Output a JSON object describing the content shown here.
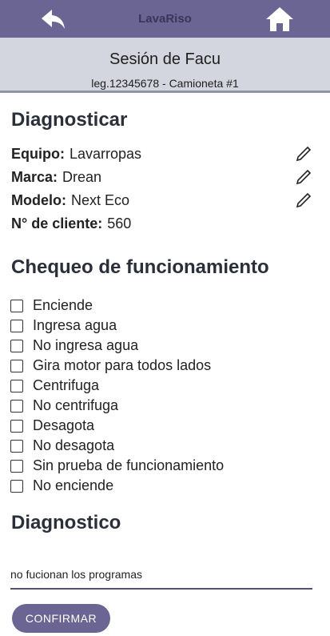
{
  "app": {
    "title": "LavaRiso"
  },
  "session": {
    "title": "Sesión de Facu",
    "subtitle": "leg.12345678 - Camioneta #1"
  },
  "diagnose": {
    "heading": "Diagnosticar",
    "fields": [
      {
        "label": "Equipo:",
        "value": "Lavarropas",
        "editable": true
      },
      {
        "label": "Marca:",
        "value": "Drean",
        "editable": true
      },
      {
        "label": "Modelo:",
        "value": "Next Eco",
        "editable": true
      },
      {
        "label": "N° de cliente:",
        "value": "560",
        "editable": false
      }
    ]
  },
  "checks": {
    "heading": "Chequeo de funcionamiento",
    "items": [
      {
        "label": "Enciende",
        "checked": false
      },
      {
        "label": "Ingresa agua",
        "checked": false
      },
      {
        "label": "No ingresa agua",
        "checked": false
      },
      {
        "label": "Gira motor para todos lados",
        "checked": false
      },
      {
        "label": "Centrifuga",
        "checked": false
      },
      {
        "label": "No centrifuga",
        "checked": false
      },
      {
        "label": "Desagota",
        "checked": false
      },
      {
        "label": "No desagota",
        "checked": false
      },
      {
        "label": "Sin prueba de funcionamiento",
        "checked": false
      },
      {
        "label": "No enciende",
        "checked": false
      }
    ]
  },
  "diagnosis": {
    "heading": "Diagnostico",
    "value": "no fucionan los programas"
  },
  "confirm_label": "CONFIRMAR",
  "icons": {
    "back": "back-arrow-icon",
    "home": "home-icon",
    "edit": "pencil-icon"
  },
  "colors": {
    "primary": "#6b6593",
    "session_bg": "#d3d6de"
  }
}
